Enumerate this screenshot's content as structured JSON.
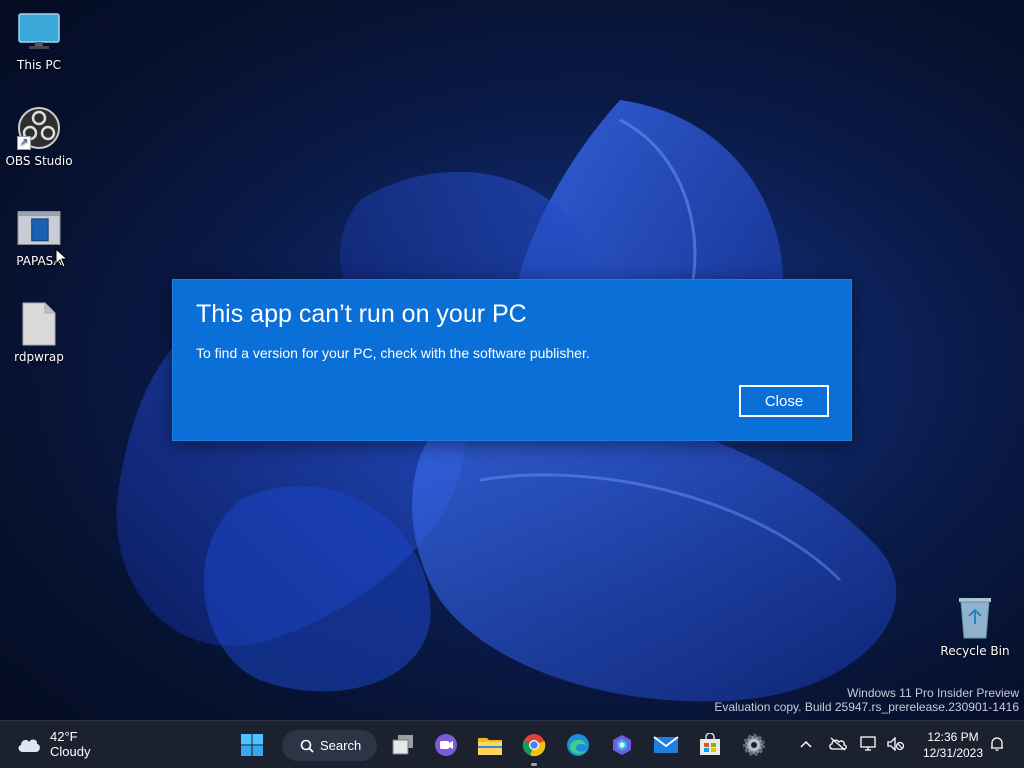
{
  "desktop": {
    "icons": [
      {
        "label": "This PC"
      },
      {
        "label": "OBS Studio"
      },
      {
        "label": "PAPASA"
      },
      {
        "label": "rdpwrap"
      },
      {
        "label": "Recycle Bin"
      }
    ],
    "watermark": {
      "line1": "Windows 11 Pro Insider Preview",
      "line2": "Evaluation copy. Build 25947.rs_prerelease.230901-1416"
    }
  },
  "dialog": {
    "title": "This app can’t run on your PC",
    "message": "To find a version for your PC, check with the software publisher.",
    "close_label": "Close",
    "background": "#0a6fd6"
  },
  "taskbar": {
    "weather": {
      "temp": "42°F",
      "condition": "Cloudy"
    },
    "search_label": "Search",
    "apps": [
      "start-icon",
      "task-view-icon",
      "teams-icon",
      "file-explorer-icon",
      "chrome-icon",
      "edge-icon",
      "copilot-icon",
      "mail-icon",
      "store-icon",
      "settings-icon"
    ],
    "clock": {
      "time": "12:36 PM",
      "date": "12/31/2023"
    }
  },
  "colors": {
    "accent": "#0a6fd6",
    "taskbar": "#1c2130"
  }
}
